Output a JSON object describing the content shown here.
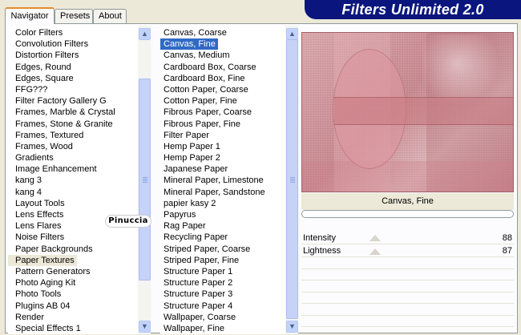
{
  "tabs": [
    {
      "label": "Navigator"
    },
    {
      "label": "Presets"
    },
    {
      "label": "About"
    }
  ],
  "banner_title": "Filters Unlimited 2.0",
  "categories": {
    "items": [
      "Color Filters",
      "Convolution Filters",
      "Distortion Filters",
      "Edges, Round",
      "Edges, Square",
      "FFG???",
      "Filter Factory Gallery G",
      "Frames, Marble & Crystal",
      "Frames, Stone & Granite",
      "Frames, Textured",
      "Frames, Wood",
      "Gradients",
      "Image Enhancement",
      "kang 3",
      "kang 4",
      "Layout Tools",
      "Lens Effects",
      "Lens Flares",
      "Noise Filters",
      "Paper Backgrounds",
      "Paper Textures",
      "Pattern Generators",
      "Photo Aging Kit",
      "Photo Tools",
      "Plugins AB 04",
      "Render",
      "Special Effects 1"
    ],
    "selected": "Paper Textures"
  },
  "filters": {
    "items": [
      "Canvas, Coarse",
      "Canvas, Fine",
      "Canvas, Medium",
      "Cardboard Box, Coarse",
      "Cardboard Box, Fine",
      "Cotton Paper, Coarse",
      "Cotton Paper, Fine",
      "Fibrous Paper, Coarse",
      "Fibrous Paper, Fine",
      "Filter Paper",
      "Hemp Paper 1",
      "Hemp Paper 2",
      "Japanese Paper",
      "Mineral Paper, Limestone",
      "Mineral Paper, Sandstone",
      "papier kasy 2",
      "Papyrus",
      "Rag Paper",
      "Recycling Paper",
      "Striped Paper, Coarse",
      "Striped Paper, Fine",
      "Structure Paper 1",
      "Structure Paper 2",
      "Structure Paper 3",
      "Structure Paper 4",
      "Wallpaper, Coarse",
      "Wallpaper, Fine"
    ],
    "selected": "Canvas, Fine"
  },
  "preview": {
    "filter_name": "Canvas, Fine",
    "progress": 0
  },
  "sliders": [
    {
      "label": "Intensity",
      "value": "88"
    },
    {
      "label": "Lightness",
      "value": "87"
    }
  ],
  "watermark": "Pinuccia",
  "scroll": {
    "categories_thumb_fraction": 0.76,
    "filters_thumb_fraction": 0.97
  }
}
